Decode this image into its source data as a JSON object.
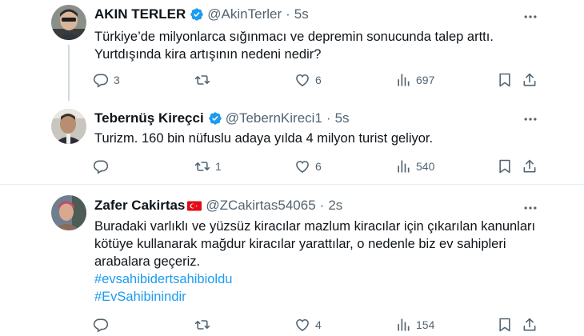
{
  "colors": {
    "accent": "#1d9bf0",
    "text": "#0f1419",
    "muted": "#536471",
    "divider": "#e6ecf0"
  },
  "tweets": [
    {
      "name": "AKIN TERLER",
      "verified": true,
      "handle": "@AkinTerler",
      "separator": "·",
      "time": "5s",
      "text": "Türkiye’de milyonlarca sığınmacı ve depremin sonucunda talep arttı. Yurtdışında kira artışının nedeni nedir?",
      "replies": "3",
      "retweets": "",
      "likes": "6",
      "views": "697"
    },
    {
      "name": "Tebernüş Kireçci",
      "verified": true,
      "handle": "@TebernKireci1",
      "separator": "·",
      "time": "5s",
      "text": "Turizm. 160 bin nüfuslu adaya yılda 4 milyon turist geliyor.",
      "replies": "",
      "retweets": "1",
      "likes": "6",
      "views": "540"
    },
    {
      "name": "Zafer Cakirtas",
      "flag": "turkey-flag-icon",
      "handle": "@ZCakirtas54065",
      "separator": "·",
      "time": "2s",
      "text": "Buradaki varlıklı ve yüzsüz kiracılar mazlum kiracılar için çıkarılan kanunları kötüye kullanarak mağdur kiracılar yarattılar, o nedenle biz ev sahipleri arabalara geçeriz.",
      "hashtags": [
        "#evsahibidertsahibioldu",
        "#EvSahibinindir"
      ],
      "replies": "",
      "retweets": "",
      "likes": "4",
      "views": "154"
    }
  ]
}
